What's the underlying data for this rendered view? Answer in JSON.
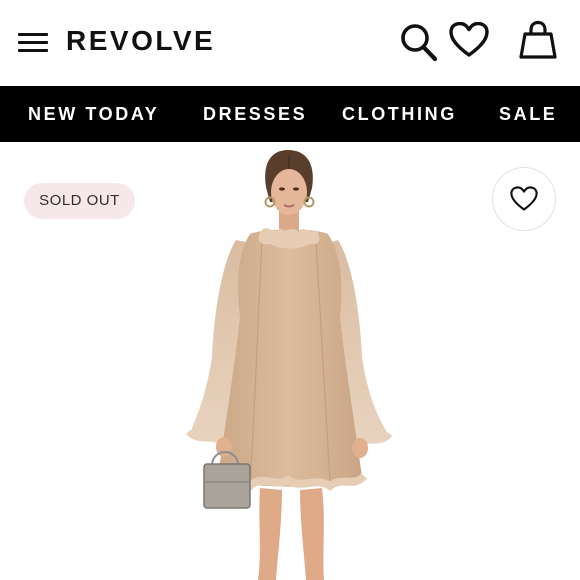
{
  "header": {
    "logo": "REVOLVE",
    "icons": [
      "menu-icon",
      "search-icon",
      "heart-icon",
      "shopping-bag-icon"
    ]
  },
  "nav": {
    "items": [
      "NEW TODAY",
      "DRESSES",
      "CLOTHING",
      "SALE"
    ]
  },
  "product": {
    "badge": "SOLD OUT",
    "image": "model wearing a beige long-sleeve ruffle mini dress with bell sleeves, holding a silver handbag",
    "dress_color": "#d9b796",
    "favorite_icon": "heart-outline-icon"
  },
  "colors": {
    "nav_bg": "#000000",
    "badge_bg": "#f6e8ea",
    "text": "#111111"
  }
}
